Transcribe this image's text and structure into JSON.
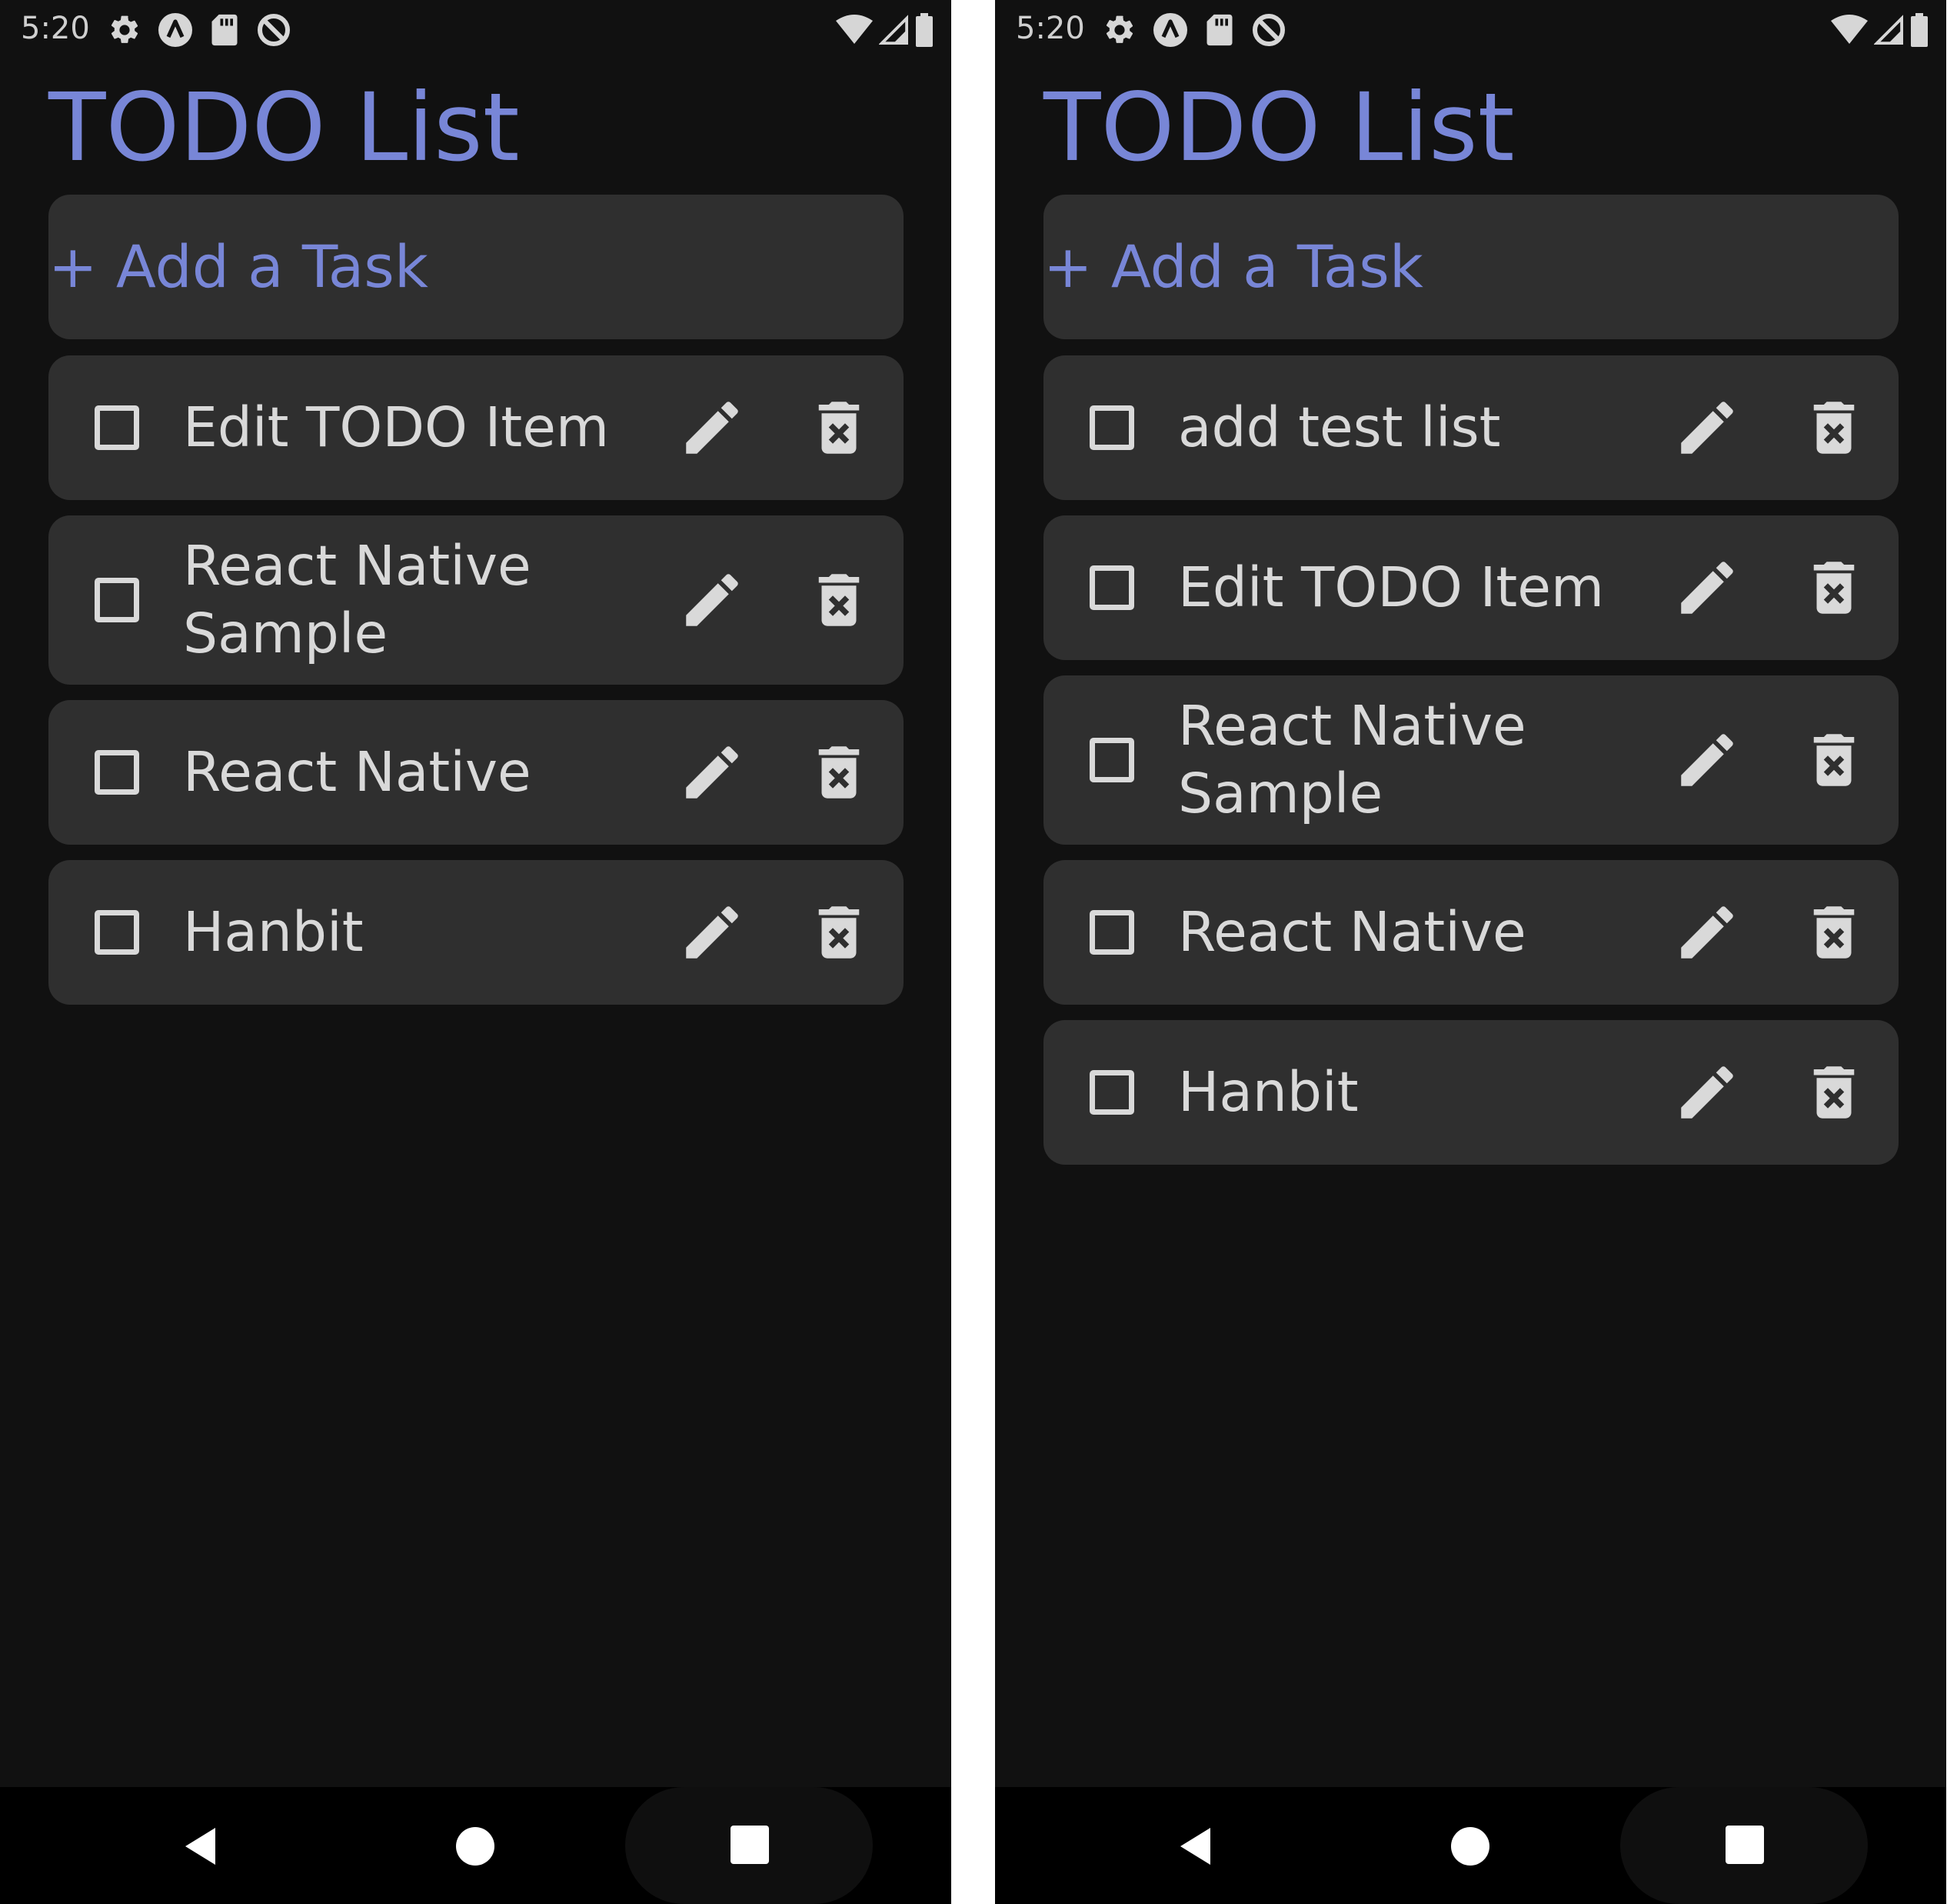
{
  "status_bar": {
    "time": "5:20",
    "left_icons": [
      "settings-icon",
      "a-badge-icon",
      "sd-card-icon",
      "sync-icon"
    ],
    "right_icons": [
      "wifi-icon",
      "signal-icon",
      "battery-icon"
    ]
  },
  "colors": {
    "background": "#111111",
    "card": "#2f2f2f",
    "accent": "#7886d7",
    "text": "#d9d9d9",
    "nav_bar": "#000000"
  },
  "screens": [
    {
      "title": "TODO List",
      "add_task_label": "+ Add a Task",
      "tasks": [
        {
          "text": "Edit TODO Item",
          "checked": false
        },
        {
          "text": "React Native Sample",
          "checked": false
        },
        {
          "text": "React Native",
          "checked": false
        },
        {
          "text": "Hanbit",
          "checked": false
        }
      ]
    },
    {
      "title": "TODO List",
      "add_task_label": "+ Add a Task",
      "tasks": [
        {
          "text": "add test list",
          "checked": false
        },
        {
          "text": "Edit TODO Item",
          "checked": false
        },
        {
          "text": "React Native Sample",
          "checked": false
        },
        {
          "text": "React Native",
          "checked": false
        },
        {
          "text": "Hanbit",
          "checked": false
        }
      ]
    }
  ],
  "nav_bar": {
    "icons": [
      "back-icon",
      "home-icon",
      "recents-icon"
    ]
  }
}
